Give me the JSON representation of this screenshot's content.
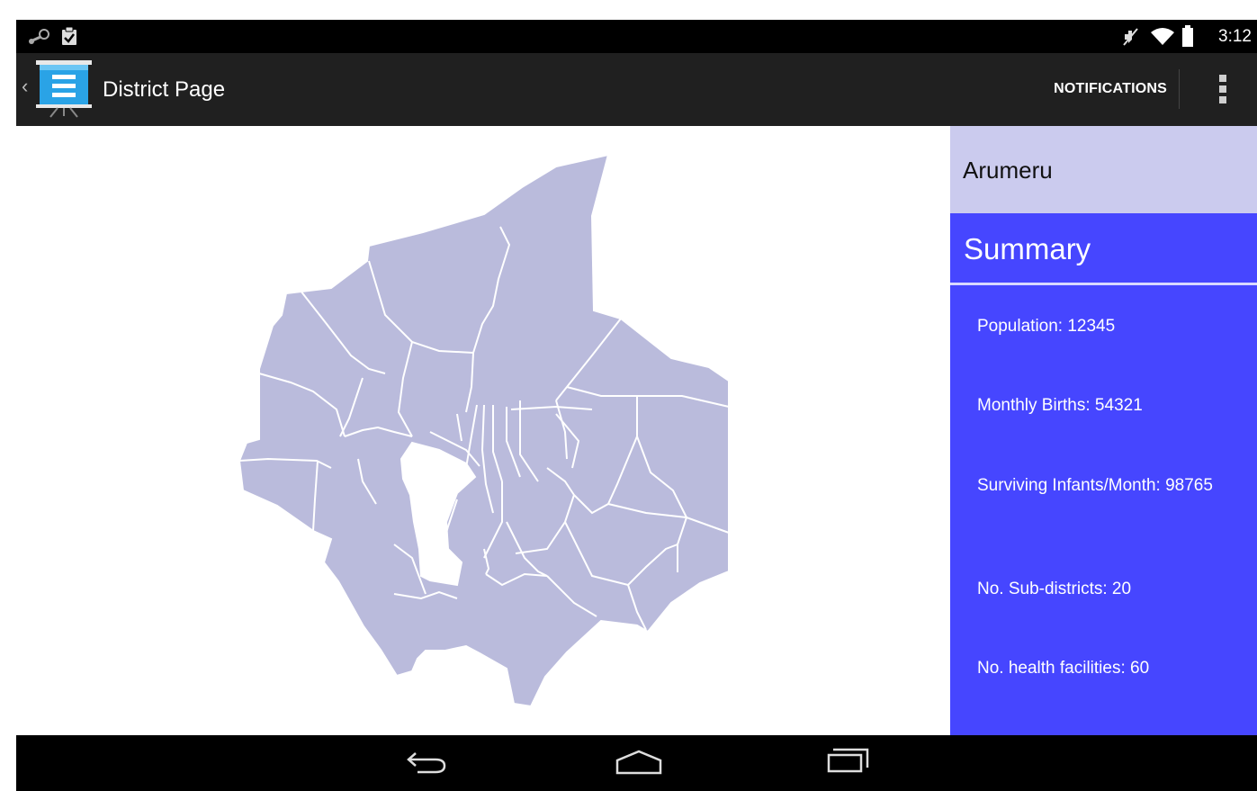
{
  "status_bar": {
    "time": "3:12",
    "left_icons": [
      "steam-icon",
      "clipboard-check-icon"
    ],
    "right_icons": [
      "mute-icon",
      "wifi-icon",
      "battery-icon"
    ]
  },
  "action_bar": {
    "title": "District Page",
    "notifications_label": "NOTIFICATIONS",
    "logo_icon": "presentation-board-icon",
    "overflow_icon": "more-vert-icon"
  },
  "map": {
    "fill_color": "#babbdc",
    "border_color": "#ffffff"
  },
  "panel": {
    "district_name": "Arumeru",
    "summary_title": "Summary",
    "stats": [
      "Population: 12345",
      "Monthly Births: 54321",
      "Surviving Infants/Month: 98765",
      "No. Sub-districts: 20",
      "No. health facilities: 60"
    ],
    "accent_color": "#4646ff",
    "header_color": "#cbcbee"
  },
  "nav_bar": {
    "icons": [
      "back-icon",
      "home-icon",
      "recents-icon"
    ]
  }
}
